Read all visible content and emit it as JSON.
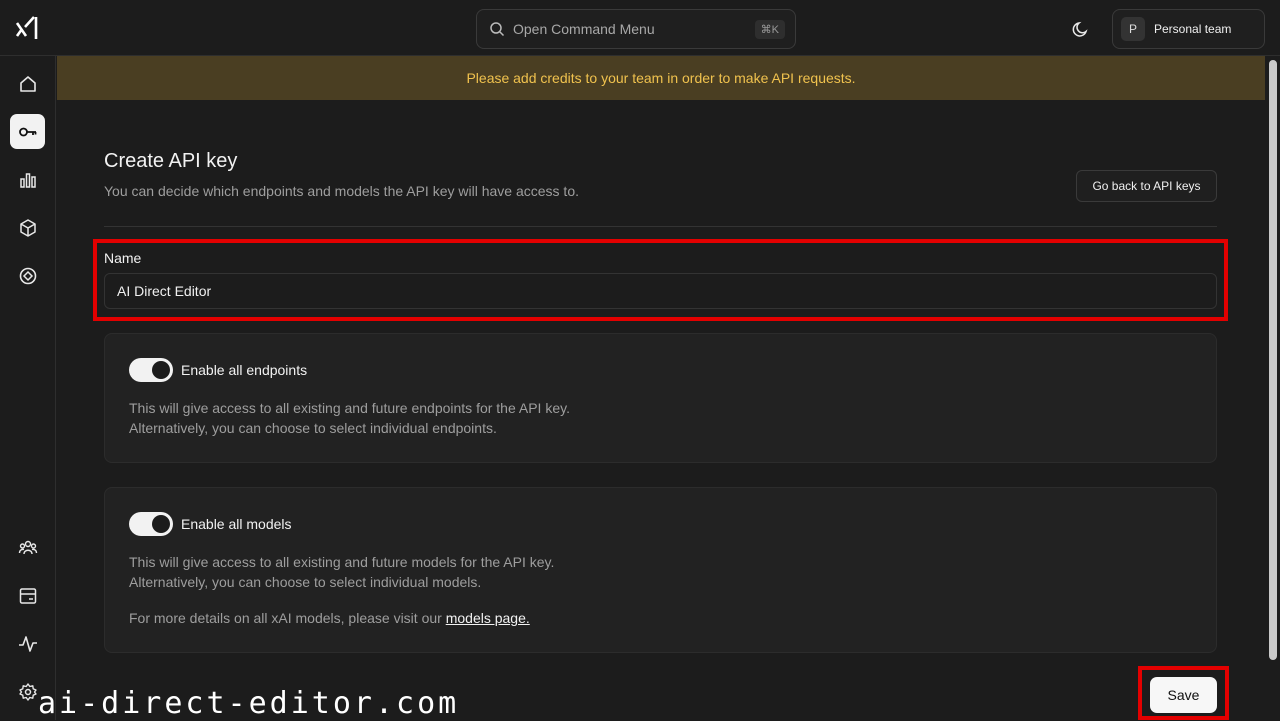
{
  "topbar": {
    "logo_icon": "xai-logo-icon",
    "command_menu": {
      "placeholder": "Open Command Menu",
      "shortcut": "⌘K",
      "icon": "search-icon"
    },
    "theme_icon": "moon-icon",
    "team": {
      "avatar": "P",
      "name": "Personal team"
    }
  },
  "sidebar": {
    "items": [
      {
        "icon": "home-icon",
        "active": false
      },
      {
        "icon": "key-icon",
        "active": true
      },
      {
        "icon": "bar-chart-icon",
        "active": false
      },
      {
        "icon": "cube-icon",
        "active": false
      },
      {
        "icon": "compass-icon",
        "active": false
      },
      {
        "icon": "users-icon",
        "active": false
      },
      {
        "icon": "billing-icon",
        "active": false
      },
      {
        "icon": "activity-icon",
        "active": false
      },
      {
        "icon": "settings-icon",
        "active": false
      }
    ]
  },
  "banner": {
    "text": "Please add credits to your team in order to make API requests."
  },
  "page": {
    "title": "Create API key",
    "subtitle": "You can decide which endpoints and models the API key will have access to.",
    "back_button": "Go back to API keys"
  },
  "form": {
    "name_label": "Name",
    "name_value": "AI Direct Editor",
    "endpoints": {
      "toggle_label": "Enable all endpoints",
      "enabled": true,
      "desc_line1": "This will give access to all existing and future endpoints for the API key.",
      "desc_line2": "Alternatively, you can choose to select individual endpoints."
    },
    "models": {
      "toggle_label": "Enable all models",
      "enabled": true,
      "desc_line1": "This will give access to all existing and future models for the API key.",
      "desc_line2": "Alternatively, you can choose to select individual models.",
      "details_prefix": "For more details on all xAI models, please visit our ",
      "details_link": "models page."
    },
    "save_button": "Save"
  },
  "watermark": "ai-direct-editor.com",
  "colors": {
    "banner_bg": "#4a3e22",
    "banner_text": "#f0c24e",
    "highlight": "#e30000",
    "background": "#1c1c1c"
  }
}
